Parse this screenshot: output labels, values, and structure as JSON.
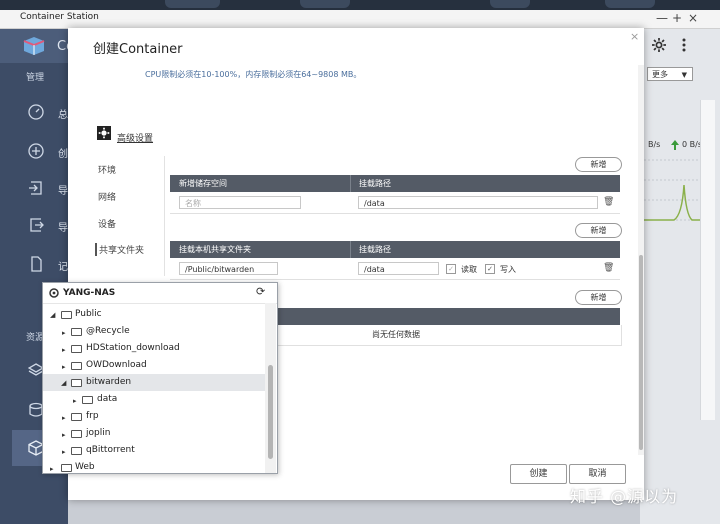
{
  "window": {
    "title": "Container Station",
    "controls": [
      "×",
      "+",
      "—"
    ]
  },
  "app": {
    "name_fragment": "Co"
  },
  "leftnav": {
    "manage_label": "管理",
    "items": [
      {
        "icon": "speedometer-icon",
        "text": "总"
      },
      {
        "icon": "plus-circle-icon",
        "text": "创"
      },
      {
        "icon": "import-icon",
        "text": "导"
      },
      {
        "icon": "export-icon",
        "text": "导"
      },
      {
        "icon": "document-icon",
        "text": "记"
      },
      {
        "icon": "layers-icon",
        "text": ""
      },
      {
        "icon": "storage-icon",
        "text": ""
      },
      {
        "icon": "cube-icon",
        "text": ""
      }
    ],
    "resource_label": "资源"
  },
  "header_icons": {
    "settings": "gear-icon",
    "more": "vertical-dots-icon"
  },
  "right_panel": {
    "more_label": "更多",
    "rate_down": "B/s",
    "rate_up": "0 B/s"
  },
  "dialog": {
    "title": "创建Container",
    "close": "×",
    "cpu_note": "CPU限制必须在10-100%，内存限制必须在64~9808 MB。",
    "advanced_settings": "高级设置",
    "side_items": [
      "环境",
      "网络",
      "设备",
      "共享文件夹"
    ],
    "add_label": "新增",
    "new_storage_table": {
      "col1": "新增储存空间",
      "col2": "挂载路径",
      "rows": [
        {
          "name_placeholder": "名称",
          "mount": "/data"
        }
      ]
    },
    "shared_folder_table": {
      "col1": "挂载本机共享文件夹",
      "col2": "挂载路径",
      "rows": [
        {
          "host": "/Public/bitwarden",
          "mount": "/data",
          "read": "读取",
          "write": "写入",
          "read_checked": true,
          "write_checked": true
        }
      ]
    },
    "empty_text": "尚无任何数据",
    "buttons": {
      "create": "创建",
      "cancel": "取消"
    }
  },
  "tree": {
    "root": "YANG-NAS",
    "nodes": [
      {
        "label": "Public",
        "depth": 0,
        "expanded": true
      },
      {
        "label": "@Recycle",
        "depth": 1
      },
      {
        "label": "HDStation_download",
        "depth": 1
      },
      {
        "label": "OWDownload",
        "depth": 1
      },
      {
        "label": "bitwarden",
        "depth": 1,
        "expanded": true,
        "selected": true
      },
      {
        "label": "data",
        "depth": 2
      },
      {
        "label": "frp",
        "depth": 1
      },
      {
        "label": "joplin",
        "depth": 1
      },
      {
        "label": "qBittorrent",
        "depth": 1
      },
      {
        "label": "Web",
        "depth": 0
      }
    ]
  },
  "watermark": "知乎 @源以为"
}
